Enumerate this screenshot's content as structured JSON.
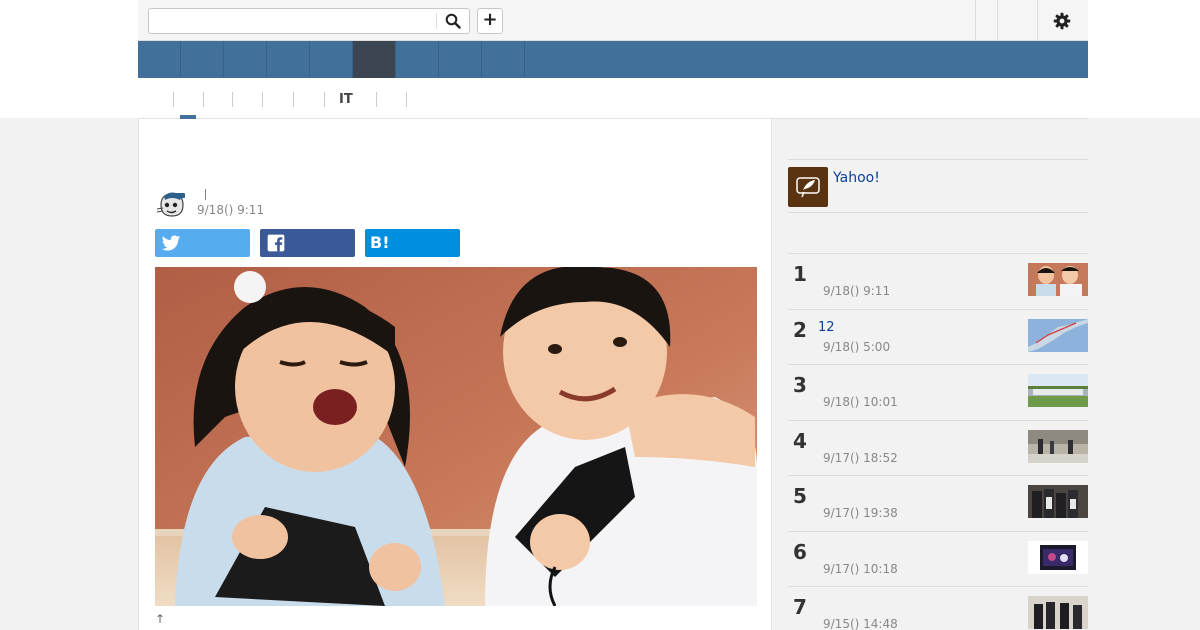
{
  "header": {
    "search_placeholder": "",
    "search_value": "",
    "add_label": "+"
  },
  "mainnav": {
    "tabs": [
      "",
      "",
      "",
      "",
      "",
      "",
      "",
      "",
      ""
    ],
    "active_index": 5
  },
  "subnav": {
    "tabs": [
      "",
      "",
      "",
      "",
      "",
      "IT",
      ""
    ],
    "active_index": 0
  },
  "article": {
    "title": "",
    "author": "",
    "date": "9/18() 9:11",
    "share": {
      "twitter": "",
      "facebook": "",
      "hatena": "B!"
    },
    "photo_caption_prefix": "↑"
  },
  "sidebar": {
    "yahoo_link": "Yahoo!",
    "ranking": [
      {
        "rank": "1",
        "title": "",
        "date": "9/18() 9:11"
      },
      {
        "rank": "2",
        "title": "12",
        "date": "9/18() 5:00"
      },
      {
        "rank": "3",
        "title": "",
        "date": "9/18() 10:01"
      },
      {
        "rank": "4",
        "title": "",
        "date": "9/17() 18:52"
      },
      {
        "rank": "5",
        "title": "",
        "date": "9/17() 19:38"
      },
      {
        "rank": "6",
        "title": "",
        "date": "9/17() 10:18"
      },
      {
        "rank": "7",
        "title": "",
        "date": "9/15() 14:48"
      }
    ]
  },
  "colors": {
    "nav_bg": "#41709a",
    "nav_active": "#3c4552",
    "link": "#0b3f99",
    "twitter": "#55acee",
    "facebook": "#3b5998",
    "hatena": "#008fde"
  },
  "icons": {
    "search": "search-icon",
    "settings": "gear-icon",
    "twitter": "twitter-icon",
    "facebook": "facebook-icon"
  }
}
